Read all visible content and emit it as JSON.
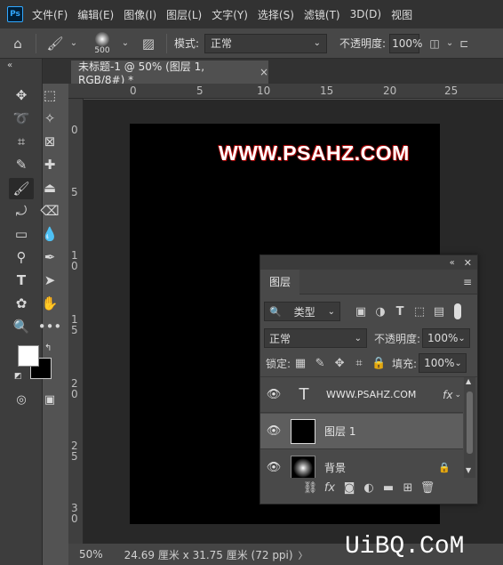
{
  "app": {
    "logo": "Ps"
  },
  "menu": [
    "文件(F)",
    "编辑(E)",
    "图像(I)",
    "图层(L)",
    "文字(Y)",
    "选择(S)",
    "滤镜(T)",
    "3D(D)",
    "视图"
  ],
  "options": {
    "brush_size": "500",
    "mode_label": "模式:",
    "mode_value": "正常",
    "opacity_label": "不透明度:",
    "opacity_value": "100%"
  },
  "document": {
    "tab_title": "未标题-1 @ 50% (图层 1, RGB/8#) *",
    "close": "×",
    "watermark_text": "WWW.PSAHZ.COM"
  },
  "rulers": {
    "top": [
      "0",
      "5",
      "10",
      "15",
      "20",
      "25"
    ],
    "left": [
      "0",
      "5",
      "10",
      "15",
      "20",
      "25",
      "30"
    ]
  },
  "status": {
    "zoom": "50%",
    "dimensions": "24.69 厘米 x 31.75 厘米 (72 ppi)",
    "arrow": "〉"
  },
  "layers_panel": {
    "title": "图层",
    "filter_label": "类型",
    "blend_mode": "正常",
    "opacity_label": "不透明度:",
    "opacity_value": "100%",
    "lock_label": "锁定:",
    "fill_label": "填充:",
    "fill_value": "100%",
    "layers": [
      {
        "name": "WWW.PSAHZ.COM",
        "kind": "text",
        "fx": "fx"
      },
      {
        "name": "图层 1",
        "kind": "pixel",
        "selected": true
      },
      {
        "name": "背景",
        "kind": "background",
        "locked": true
      }
    ],
    "footer_icons": [
      "link-icon",
      "fx-icon",
      "mask-icon",
      "adjustment-icon",
      "folder-icon",
      "new-layer-icon",
      "trash-icon"
    ],
    "fx_footer": "fx"
  },
  "brand_footer": "UiBQ.CoM",
  "colors": {
    "menubar": "#323232",
    "canvas": "#000000",
    "panel": "#494949",
    "accent": "#31a8ff"
  }
}
